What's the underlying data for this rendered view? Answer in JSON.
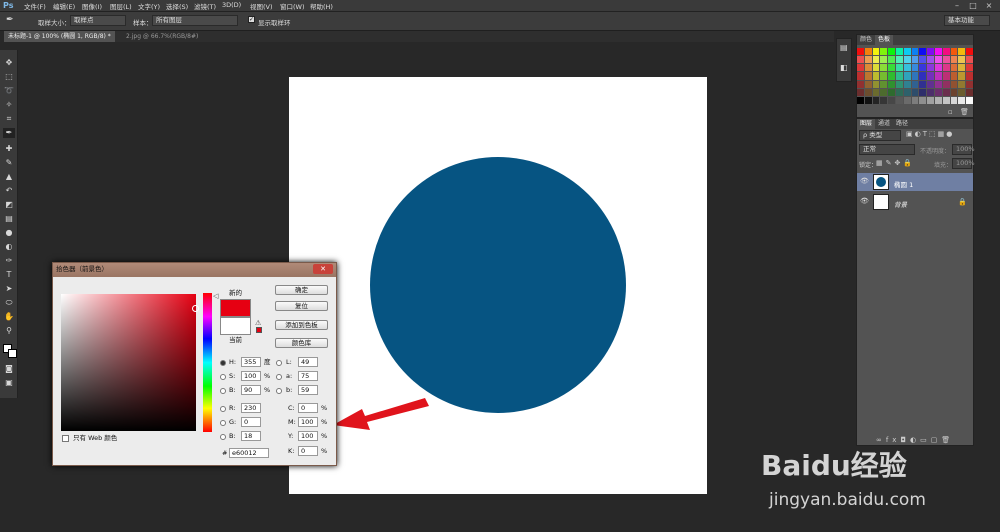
{
  "menubar": {
    "logo": "Ps",
    "items": [
      "文件(F)",
      "编辑(E)",
      "图像(I)",
      "图层(L)",
      "文字(Y)",
      "选择(S)",
      "滤镜(T)",
      "3D(D)",
      "视图(V)",
      "窗口(W)",
      "帮助(H)"
    ]
  },
  "options": {
    "sample_size_label": "取样大小：",
    "sample_size_value": "取样点",
    "sample_label": "样本：",
    "sample_value": "所有图层",
    "show_ring": "显示取样环",
    "workspace": "基本功能"
  },
  "tabs": [
    {
      "label": "未标题-1 @ 100% (椭圆 1, RGB/8) *"
    },
    {
      "label": "2.jpg @ 66.7%(RGB/8#)"
    }
  ],
  "swatches_panel": {
    "tabs": [
      "颜色",
      "色板"
    ]
  },
  "layers_panel": {
    "tabs": [
      "图层",
      "通道",
      "路径"
    ],
    "filter_kind": "ρ 类型",
    "blend_mode": "正常",
    "opacity_label": "不透明度：",
    "opacity_value": "100%",
    "lock_label": "锁定：",
    "fill_label": "填充：",
    "fill_value": "100%",
    "layers": [
      {
        "name": "椭圆 1"
      },
      {
        "name": "背景"
      }
    ]
  },
  "dialog": {
    "title": "拾色器（前景色）",
    "new_label": "新的",
    "current_label": "当前",
    "ok": "确定",
    "reset": "复位",
    "add_to_swatches": "添加到色板",
    "color_libraries": "颜色库",
    "web_only": "只有 Web 颜色",
    "fields": {
      "H": "355",
      "S": "100",
      "B": "90",
      "R": "230",
      "G": "0",
      "Bl": "18",
      "L": "49",
      "a": "75",
      "b": "59",
      "C": "0",
      "M": "100",
      "Y": "100",
      "K": "0"
    },
    "units": {
      "H": "度",
      "S": "%",
      "B": "%",
      "C": "%",
      "M": "%",
      "Y": "%",
      "K": "%"
    },
    "hex": "e60012",
    "labels": {
      "H": "H:",
      "S": "S:",
      "B": "B:",
      "R": "R:",
      "G": "G:",
      "Bl": "B:",
      "L": "L:",
      "a": "a:",
      "b": "b:",
      "C": "C:",
      "M": "M:",
      "Y": "Y:",
      "K": "K:",
      "hash": "#"
    }
  },
  "watermark": {
    "brand": "Baidu经验",
    "url": "jingyan.baidu.com"
  },
  "colors": {
    "circle": "#065482",
    "new_color": "#e60012",
    "arrow": "#e0141c"
  }
}
